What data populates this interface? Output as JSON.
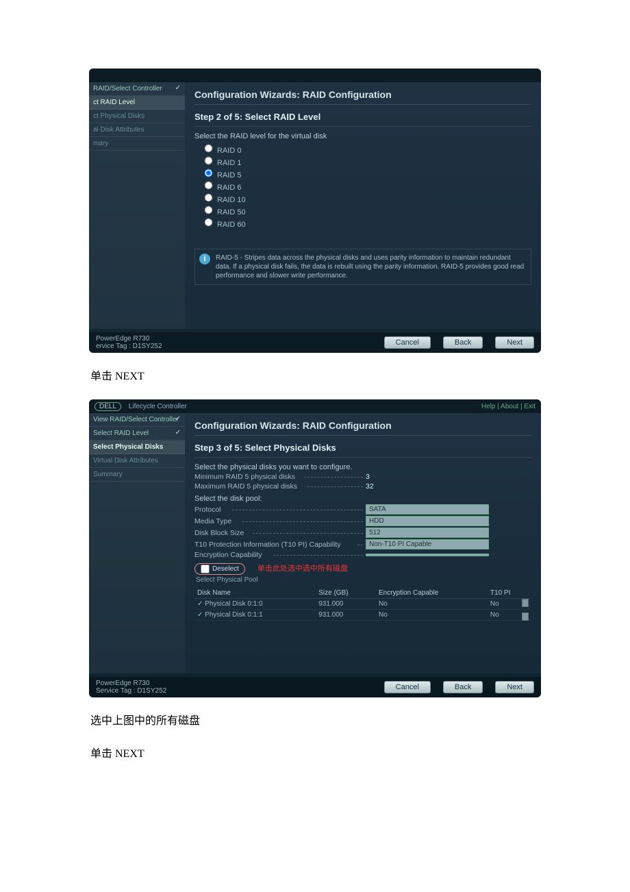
{
  "shot1": {
    "sidebar": {
      "controller": "RAID/Select Controller",
      "level": "ct RAID Level",
      "physical": "ct Physical Disks",
      "attrs": "al Disk Attributes",
      "summary": "mary"
    },
    "title": "Configuration Wizards: RAID Configuration",
    "step": "Step 2 of 5: Select RAID Level",
    "sub": "Select the RAID level for the virtual disk",
    "options": [
      "RAID 0",
      "RAID 1",
      "RAID 5",
      "RAID 6",
      "RAID 10",
      "RAID 50",
      "RAID 60"
    ],
    "selected": "RAID 5",
    "info": "RAID-5 - Stripes data across the physical disks and uses parity information to maintain redundant data. If a physical disk fails, the data is rebuilt using the parity information. RAID-5 provides good read performance and slower write performance.",
    "model": "PowerEdge R730",
    "tag": "ervice Tag : D1SY252",
    "cancel": "Cancel",
    "back": "Back",
    "next": "Next"
  },
  "caption1": "单击 NEXT",
  "shot2": {
    "brand": "DELL",
    "lc": "Lifecycle Controller",
    "toplinks": "Help | About | Exit",
    "sidebar": {
      "controller": "View RAID/Select Controller",
      "level": "Select RAID Level",
      "physical": "Select Physical Disks",
      "attrs": "Virtual Disk Attributes",
      "summary": "Summary"
    },
    "title": "Configuration Wizards: RAID Configuration",
    "step": "Step 3 of 5: Select Physical Disks",
    "sub": "Select the physical disks you want to configure.",
    "min_label": "Minimum RAID 5 physical disks",
    "min_val": "3",
    "max_label": "Maximum RAID 5 physical disks",
    "max_val": "32",
    "pool": "Select the disk pool:",
    "protocol_label": "Protocol",
    "protocol_val": "SATA",
    "media_label": "Media Type",
    "media_val": "HDD",
    "block_label": "Disk Block Size",
    "block_val": "512",
    "t10_label": "T10 Protection Information (T10 PI) Capability",
    "t10_val": "Non-T10 PI Capable",
    "enc_label": "Encryption Capability",
    "enc_val": "",
    "deselect": "Deselect",
    "red": "单击此处选中选中所有磁盘",
    "poolnote": "Select Physical Pool",
    "headers": {
      "name": "Disk Name",
      "size": "Size (GB)",
      "enc": "Encryption Capable",
      "t10": "T10 PI"
    },
    "rows": [
      {
        "name": "Physical Disk 0:1:0",
        "size": "931.000",
        "enc": "No",
        "t10": "No"
      },
      {
        "name": "Physical Disk 0:1:1",
        "size": "931.000",
        "enc": "No",
        "t10": "No"
      }
    ],
    "model": "PowerEdge R730",
    "tag": "Service Tag : D1SY252",
    "cancel": "Cancel",
    "back": "Back",
    "next": "Next"
  },
  "caption2a": "选中上图中的所有磁盘",
  "caption2b": "单击 NEXT"
}
